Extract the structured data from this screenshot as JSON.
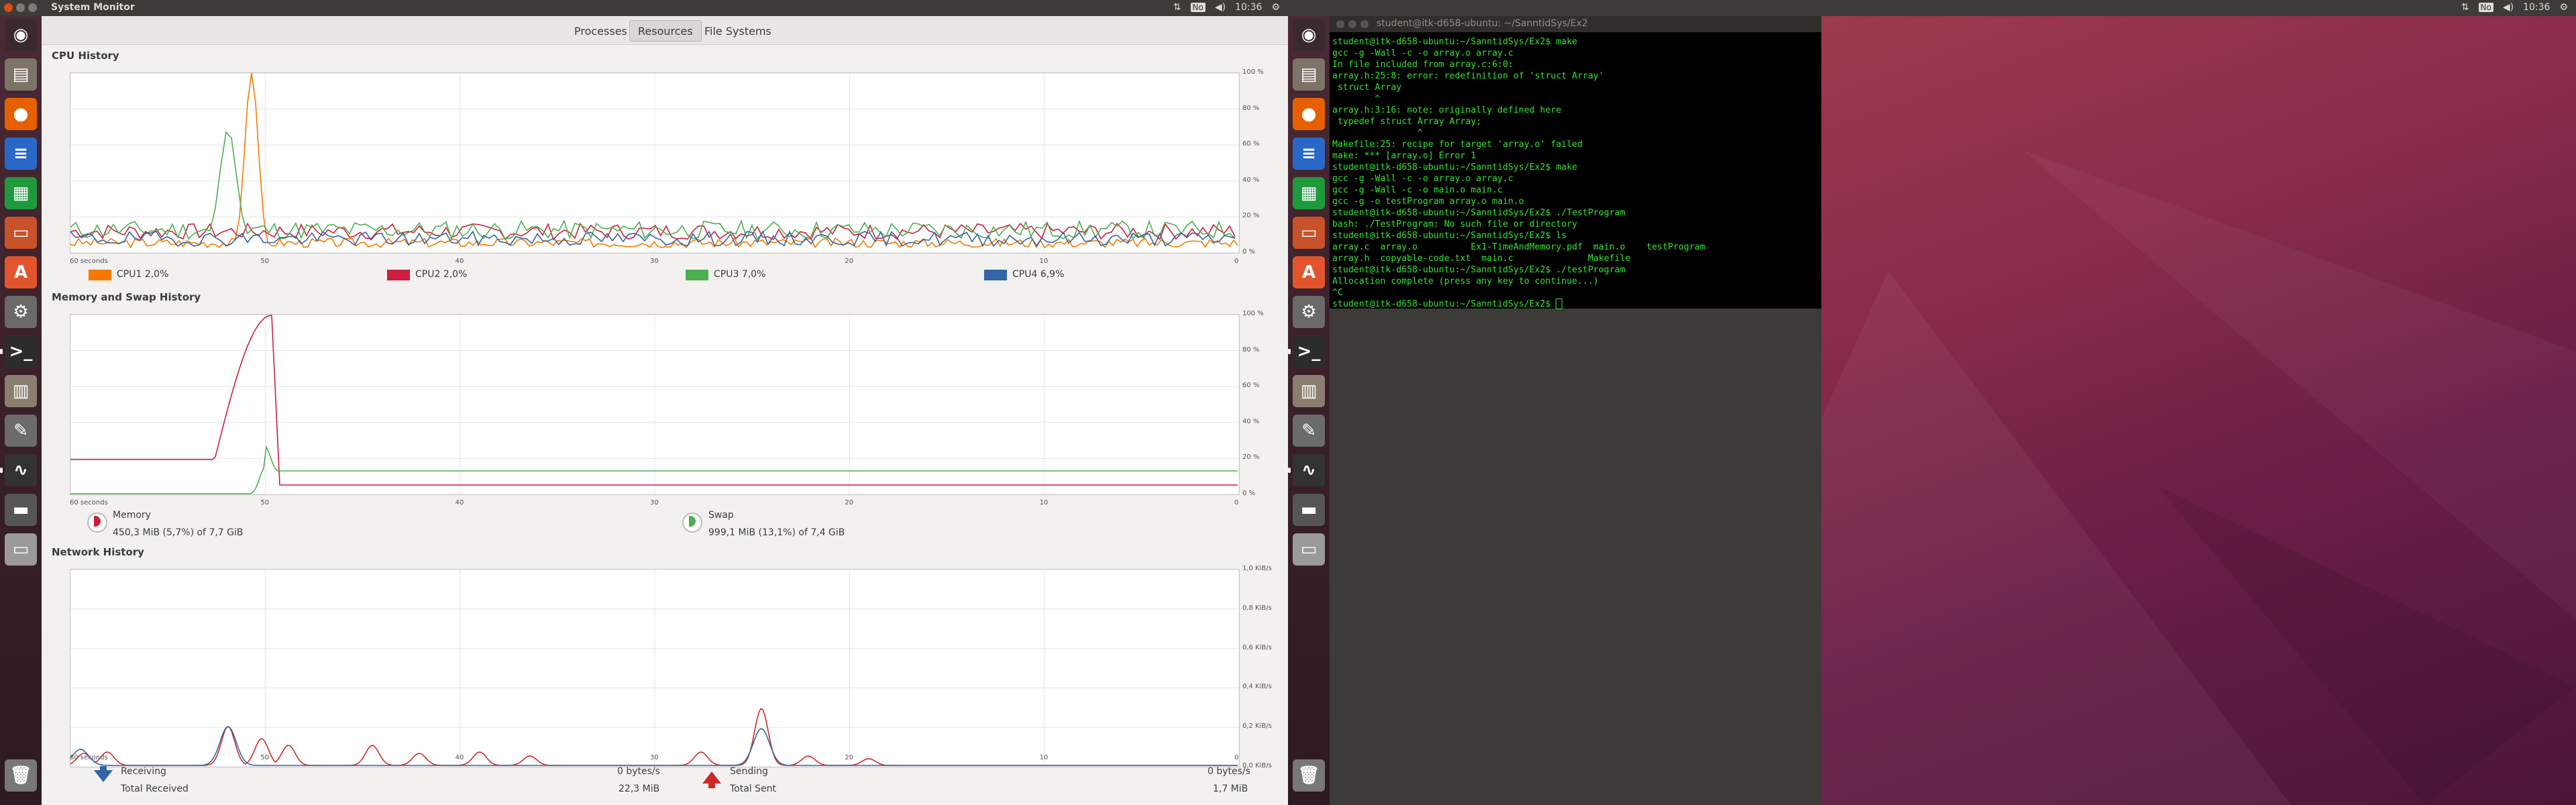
{
  "left_panel": {
    "title": "System Monitor",
    "time": "10:36",
    "keyboard_indicator": "No"
  },
  "right_panel": {
    "time": "10:36",
    "keyboard_indicator": "No"
  },
  "tabs": [
    "Processes",
    "Resources",
    "File Systems"
  ],
  "active_tab": "Resources",
  "cpu": {
    "title": "CPU History",
    "y_ticks": [
      "100 %",
      "80 %",
      "60 %",
      "40 %",
      "20 %",
      "0 %"
    ],
    "x_ticks": [
      "60 seconds",
      "50",
      "40",
      "30",
      "20",
      "10",
      "0"
    ],
    "legend": [
      {
        "label": "CPU1",
        "value": "2,0%",
        "color": "#f57900"
      },
      {
        "label": "CPU2",
        "value": "2,0%",
        "color": "#cc1f3f"
      },
      {
        "label": "CPU3",
        "value": "7,0%",
        "color": "#4caf50"
      },
      {
        "label": "CPU4",
        "value": "6,9%",
        "color": "#3465a4"
      }
    ]
  },
  "memory": {
    "title": "Memory and Swap History",
    "y_ticks": [
      "100 %",
      "80 %",
      "60 %",
      "40 %",
      "20 %",
      "0 %"
    ],
    "x_ticks": [
      "60 seconds",
      "50",
      "40",
      "30",
      "20",
      "10",
      "0"
    ],
    "mem_label": "Memory",
    "mem_value": "450,3 MiB (5,7%) of 7,7 GiB",
    "swap_label": "Swap",
    "swap_value": "999,1 MiB (13,1%) of 7,4 GiB",
    "mem_color": "#cc1f3f",
    "swap_color": "#4caf50"
  },
  "network": {
    "title": "Network History",
    "y_ticks": [
      "1,0 KiB/s",
      "0,8 KiB/s",
      "0,6 KiB/s",
      "0,4 KiB/s",
      "0,2 KiB/s",
      "0,0 KiB/s"
    ],
    "x_ticks": [
      "60 seconds",
      "50",
      "40",
      "30",
      "20",
      "10",
      "0"
    ],
    "receiving_label": "Receiving",
    "receiving_rate": "0 bytes/s",
    "total_received_label": "Total Received",
    "total_received": "22,3 MiB",
    "sending_label": "Sending",
    "sending_rate": "0 bytes/s",
    "total_sent_label": "Total Sent",
    "total_sent": "1,7 MiB"
  },
  "terminal": {
    "title": "student@itk-d658-ubuntu: ~/SanntidSys/Ex2",
    "lines": [
      "student@itk-d658-ubuntu:~/SanntidSys/Ex2$ make",
      "gcc -g -Wall -c -o array.o array.c",
      "In file included from array.c:6:0:",
      "array.h:25:8: error: redefinition of 'struct Array'",
      " struct Array",
      "        ^",
      "array.h:3:16: note: originally defined here",
      " typedef struct Array Array;",
      "                ^",
      "Makefile:25: recipe for target 'array.o' failed",
      "make: *** [array.o] Error 1",
      "student@itk-d658-ubuntu:~/SanntidSys/Ex2$ make",
      "gcc -g -Wall -c -o array.o array.c",
      "gcc -g -Wall -c -o main.o main.c",
      "gcc -g -o testProgram array.o main.o",
      "student@itk-d658-ubuntu:~/SanntidSys/Ex2$ ./TestProgram",
      "bash: ./TestProgram: No such file or directory",
      "student@itk-d658-ubuntu:~/SanntidSys/Ex2$ ls",
      "array.c  array.o          Ex1-TimeAndMemory.pdf  main.o    testProgram",
      "array.h  copyable-code.txt  main.c              Makefile",
      "student@itk-d658-ubuntu:~/SanntidSys/Ex2$ ./testProgram",
      "Allocation complete (press any key to continue...)",
      "^C",
      "student@itk-d658-ubuntu:~/SanntidSys/Ex2$ "
    ]
  },
  "launcher_icons": [
    "dash-icon",
    "files-icon",
    "firefox-icon",
    "writer-icon",
    "calc-icon",
    "impress-icon",
    "software-center-icon",
    "settings-icon",
    "terminal-icon",
    "file-cabinet-icon",
    "text-editor-icon",
    "system-monitor-icon",
    "drive-icon",
    "usb-drive-icon",
    "trash-icon"
  ]
}
